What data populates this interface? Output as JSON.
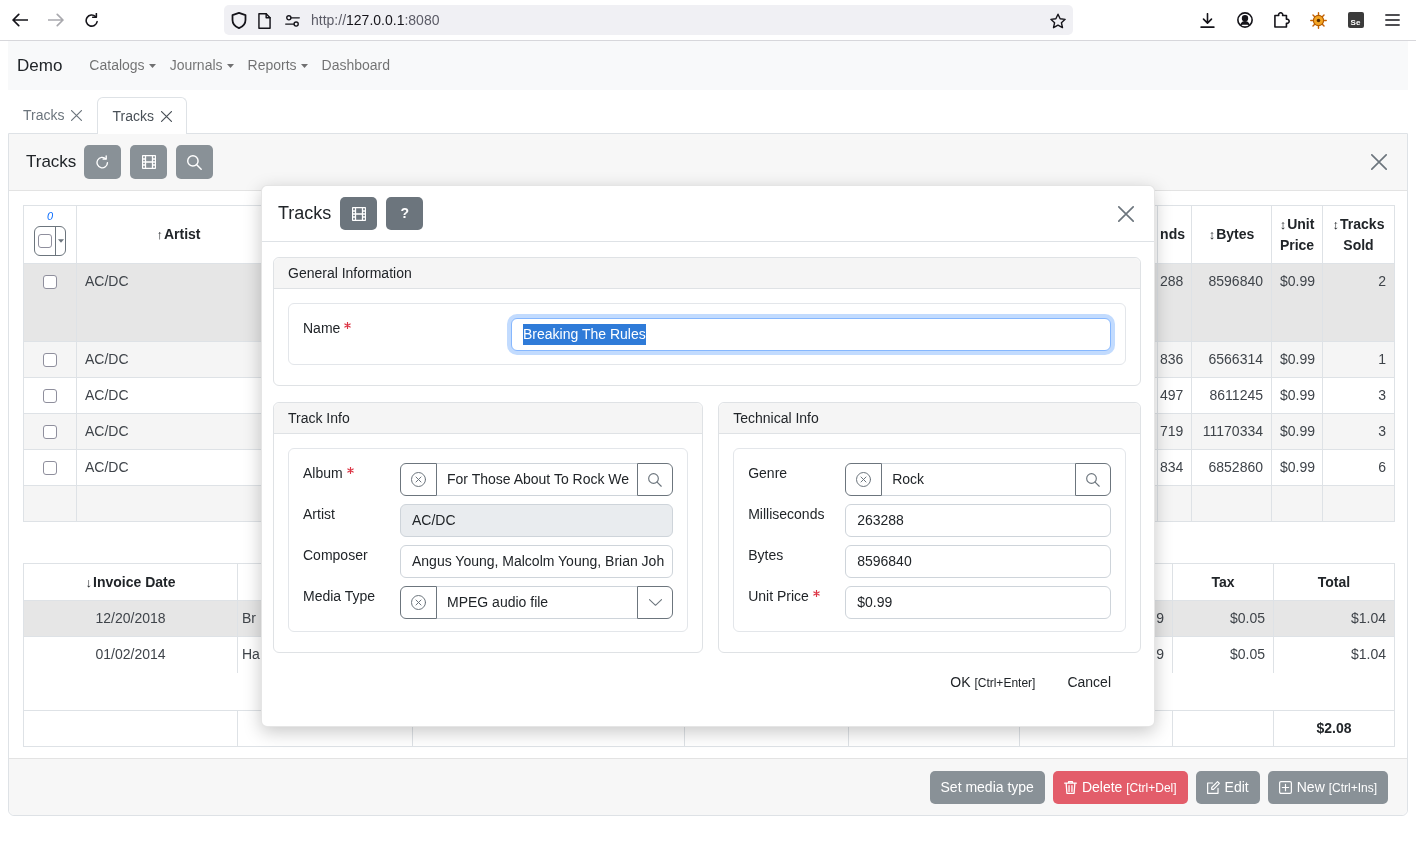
{
  "browser": {
    "nav_buttons": [
      {
        "kind": "back",
        "disabled": false
      },
      {
        "kind": "forward",
        "disabled": true
      },
      {
        "kind": "reload",
        "disabled": false
      }
    ],
    "url": {
      "scheme": "http://",
      "host": "127.0.0.1",
      "port": ":8080"
    },
    "extension_label": "Se"
  },
  "navbar": {
    "brand": "Demo",
    "items": [
      {
        "label": "Catalogs",
        "dropdown": true
      },
      {
        "label": "Journals",
        "dropdown": true
      },
      {
        "label": "Reports",
        "dropdown": true
      },
      {
        "label": "Dashboard",
        "dropdown": false
      }
    ]
  },
  "tabs": [
    {
      "label": "Tracks",
      "selected": false
    },
    {
      "label": "Tracks",
      "selected": true
    }
  ],
  "panel": {
    "title": "Tracks",
    "tracks_table": {
      "selected_count": "0",
      "select_all_checked": false,
      "columns": [
        {
          "label": "Artist",
          "sort_mark": "↑"
        },
        {
          "label": "nds"
        },
        {
          "label": "Bytes",
          "sort_mark": "↕"
        },
        {
          "label": "Unit Price",
          "sort_mark": "↕"
        },
        {
          "label": "Tracks Sold",
          "sort_mark": "↕"
        }
      ],
      "rows": [
        {
          "selected": true,
          "checked": false,
          "cells": [
            "AC/DC",
            "288",
            "8596840",
            "$0.99",
            "2"
          ]
        },
        {
          "selected": false,
          "checked": false,
          "cells": [
            "AC/DC",
            "836",
            "6566314",
            "$0.99",
            "1"
          ]
        },
        {
          "selected": false,
          "checked": false,
          "cells": [
            "AC/DC",
            "497",
            "8611245",
            "$0.99",
            "3"
          ]
        },
        {
          "selected": false,
          "checked": false,
          "cells": [
            "AC/DC",
            "719",
            "11170334",
            "$0.99",
            "3"
          ]
        },
        {
          "selected": false,
          "checked": false,
          "cells": [
            "AC/DC",
            "834",
            "6852860",
            "$0.99",
            "6"
          ]
        }
      ]
    },
    "invoices_table": {
      "columns": [
        {
          "label": "Invoice Date",
          "sort_mark": "↓"
        },
        {
          "label": "Tax"
        },
        {
          "label": "Total"
        }
      ],
      "rows": [
        {
          "selected": true,
          "invoice_date": "12/20/2018",
          "column_2": "Br",
          "column_6": "9",
          "tax": "$0.05",
          "total": "$1.04"
        },
        {
          "selected": false,
          "invoice_date": "01/02/2014",
          "column_2": "Ha",
          "column_6": "9",
          "tax": "$0.05",
          "total": "$1.04"
        }
      ],
      "total": "$2.08"
    },
    "actions": [
      {
        "kind": "plain",
        "label": "Set media type"
      },
      {
        "kind": "delete",
        "label": "Delete",
        "shortcut": "[Ctrl+Del]"
      },
      {
        "kind": "edit",
        "label": "Edit"
      },
      {
        "kind": "new",
        "label": "New",
        "shortcut": "[Ctrl+Ins]"
      }
    ]
  },
  "dialog": {
    "title": "Tracks",
    "help_label": "?",
    "sections": [
      {
        "title": "General Information",
        "fields": [
          {
            "kind": "text",
            "label": "Name",
            "required": true,
            "value": "Breaking The Rules",
            "focused": true,
            "text_selected": true
          }
        ]
      },
      {
        "title": "Track Info",
        "fields": [
          {
            "kind": "lookup",
            "label": "Album",
            "required": true,
            "value": "For Those About To Rock We",
            "focused": false,
            "text_selected": false
          },
          {
            "kind": "readonly",
            "label": "Artist",
            "required": false,
            "value": "AC/DC",
            "focused": false,
            "text_selected": false
          },
          {
            "kind": "text",
            "label": "Composer",
            "required": false,
            "value": "Angus Young, Malcolm Young, Brian Joh",
            "focused": false,
            "text_selected": false
          },
          {
            "kind": "select",
            "label": "Media Type",
            "required": false,
            "value": "MPEG audio file",
            "focused": false,
            "text_selected": false
          }
        ]
      },
      {
        "title": "Technical Info",
        "fields": [
          {
            "kind": "lookup",
            "label": "Genre",
            "required": false,
            "value": "Rock",
            "focused": false,
            "text_selected": false
          },
          {
            "kind": "text",
            "label": "Milliseconds",
            "required": false,
            "value": "263288",
            "focused": false,
            "text_selected": false
          },
          {
            "kind": "text",
            "label": "Bytes",
            "required": false,
            "value": "8596840",
            "focused": false,
            "text_selected": false
          },
          {
            "kind": "text",
            "label": "Unit Price",
            "required": true,
            "value": "$0.99",
            "focused": false,
            "text_selected": false
          }
        ]
      }
    ],
    "ok": {
      "label": "OK",
      "shortcut": "[Ctrl+Enter]"
    },
    "cancel": "Cancel"
  }
}
